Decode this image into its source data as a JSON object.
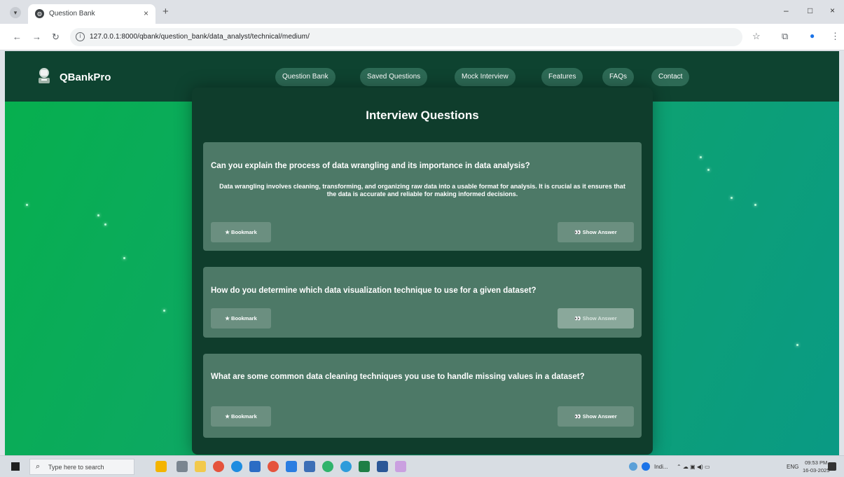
{
  "browser": {
    "tab_title": "Question Bank",
    "tab_close": "×",
    "new_tab": "+",
    "url": "127.0.0.1:8000/qbank/question_bank/data_analyst/technical/medium/",
    "win_min": "–",
    "win_max": "□",
    "win_close": "×"
  },
  "site": {
    "brand": "QBankPro",
    "nav": [
      "Question Bank",
      "Saved Questions",
      "Mock Interview",
      "Features",
      "FAQs",
      "Contact"
    ]
  },
  "main": {
    "title": "Interview Questions",
    "questions": [
      {
        "question": "Can you explain the process of data wrangling and its importance in data analysis?",
        "answer": "Data wrangling involves cleaning, transforming, and organizing raw data into a usable format for analysis. It is crucial as it ensures that the data is accurate and reliable for making informed decisions.",
        "bookmark": "★ Bookmark",
        "show_answer": "👀 Show Answer"
      },
      {
        "question": "How do you determine which data visualization technique to use for a given dataset?",
        "bookmark": "★ Bookmark",
        "show_answer": "👀 Show Answer"
      },
      {
        "question": "What are some common data cleaning techniques you use to handle missing values in a dataset?",
        "bookmark": "★ Bookmark",
        "show_answer": "👀 Show Answer"
      }
    ]
  },
  "taskbar": {
    "search_placeholder": "Type here to search",
    "weather": "Indi...",
    "lang": "ENG",
    "time": "09:53 PM",
    "date": "16-03-2025"
  },
  "colors": {
    "navbar": "#0e4330",
    "panel": "#0f3d2c",
    "card": "#4d7967",
    "button": "#6b8f80",
    "page_gradient_start": "#06b04d",
    "page_gradient_end": "#0a9a84"
  }
}
